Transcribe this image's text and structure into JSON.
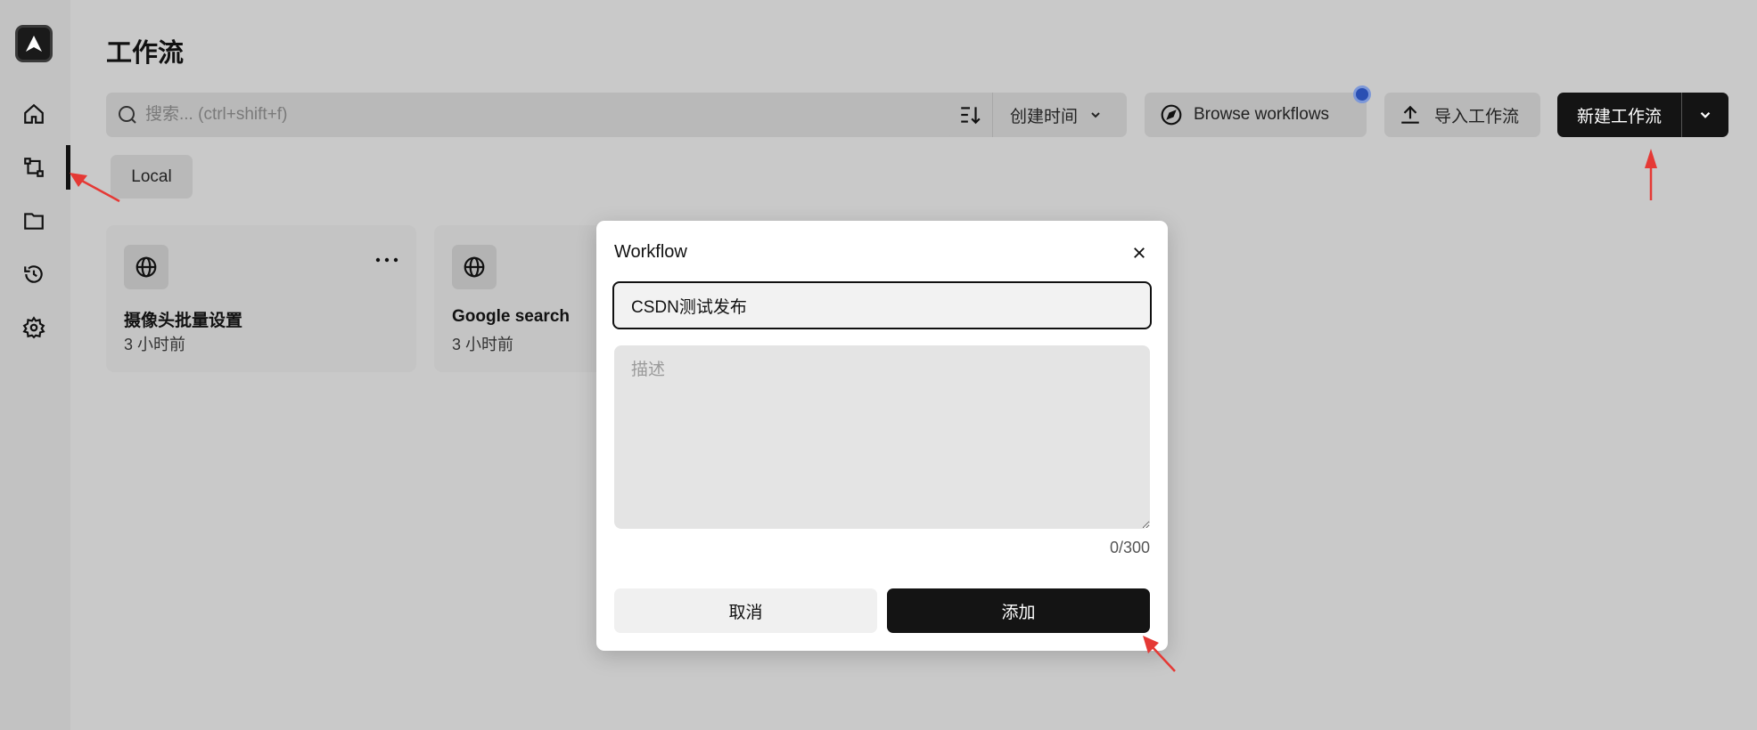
{
  "sidebar": {
    "items": [
      {
        "name": "home",
        "icon": "home-icon"
      },
      {
        "name": "workflows",
        "icon": "workflow-icon",
        "active": true
      },
      {
        "name": "files",
        "icon": "folder-icon"
      },
      {
        "name": "history",
        "icon": "history-icon"
      },
      {
        "name": "settings",
        "icon": "gear-icon"
      }
    ]
  },
  "header": {
    "title": "工作流",
    "search_placeholder": "搜索... (ctrl+shift+f)",
    "sort_label": "创建时间",
    "browse_label": "Browse workflows",
    "import_label": "导入工作流",
    "new_label": "新建工作流"
  },
  "filters": {
    "tag": "Local"
  },
  "cards": [
    {
      "title": "摄像头批量设置",
      "time": "3 小时前"
    },
    {
      "title": "Google search",
      "time": "3 小时前"
    }
  ],
  "modal": {
    "title": "Workflow",
    "name_value": "CSDN测试发布",
    "desc_placeholder": "描述",
    "counter": "0/300",
    "cancel_label": "取消",
    "add_label": "添加"
  },
  "colors": {
    "accent_dark": "#141414",
    "notification_dot": "#2a4fb3",
    "annotation_arrow": "#e53935"
  }
}
